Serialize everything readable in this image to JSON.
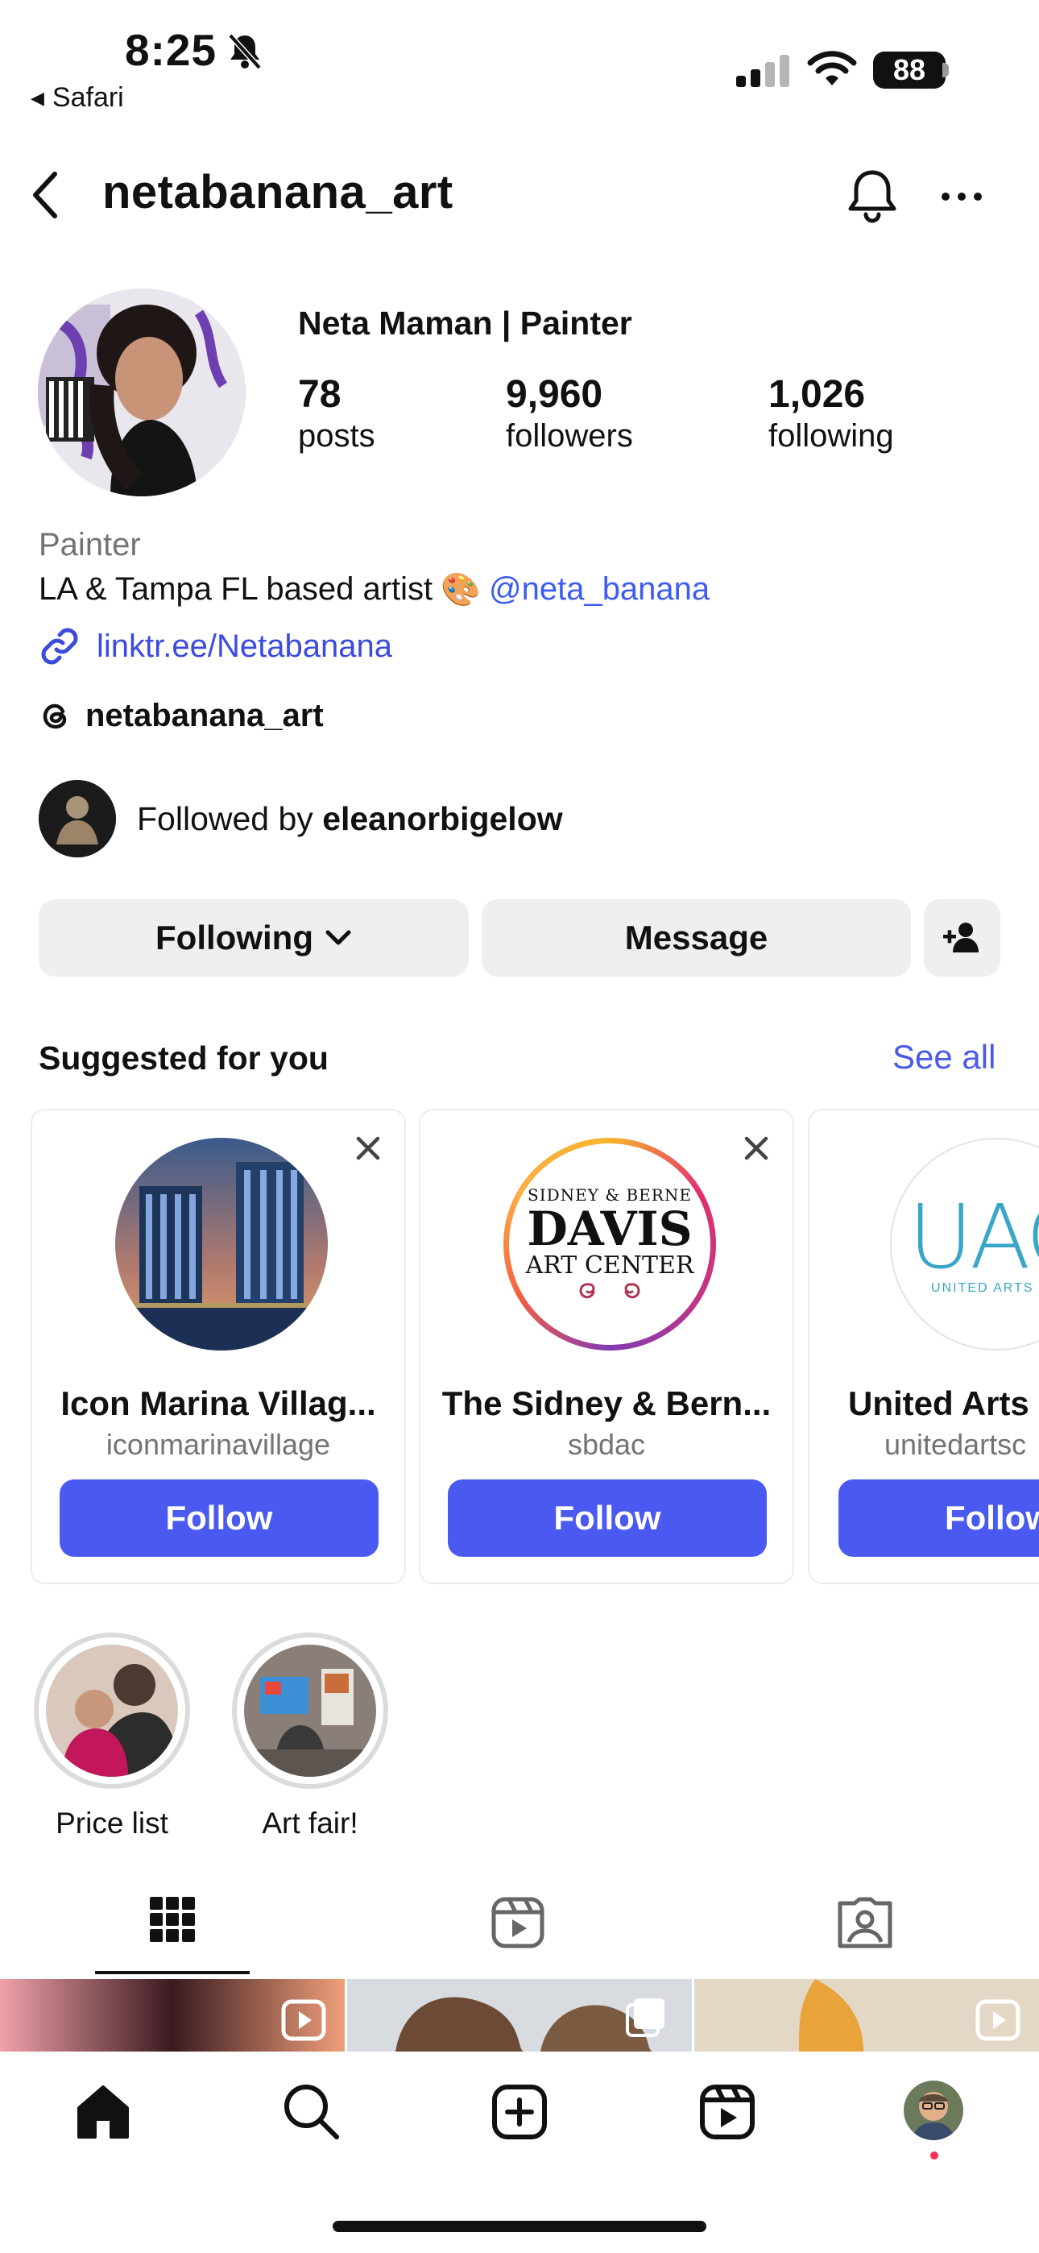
{
  "status_bar": {
    "time": "8:25",
    "back_app": "Safari",
    "battery": "88"
  },
  "header": {
    "username": "netabanana_art",
    "back_icon": "chevron-left-icon",
    "bell_icon": "bell-icon",
    "more_icon": "more-horizontal-icon"
  },
  "profile": {
    "display_name": "Neta Maman | Painter",
    "stats": [
      {
        "count": "78",
        "label": "posts"
      },
      {
        "count": "9,960",
        "label": "followers"
      },
      {
        "count": "1,026",
        "label": "following"
      }
    ],
    "category": "Painter",
    "bio_text": "LA & Tampa FL based artist",
    "bio_emoji": "🎨",
    "bio_mention": "@neta_banana",
    "link": "linktr.ee/Netabanana",
    "threads_handle": "netabanana_art",
    "followed_by_prefix": "Followed by",
    "followed_by_user": "eleanorbigelow"
  },
  "actions": {
    "following": "Following",
    "message": "Message"
  },
  "suggested": {
    "title": "Suggested for you",
    "see_all": "See all",
    "cards": [
      {
        "name": "Icon Marina Villag...",
        "handle": "iconmarinavillage",
        "button": "Follow"
      },
      {
        "name": "The Sidney & Bern...",
        "handle": "sbdac",
        "button": "Follow"
      },
      {
        "name": "United Arts",
        "handle": "unitedartsc",
        "button": "Follow"
      }
    ],
    "davis_logo": {
      "line1": "SIDNEY & BERNE",
      "line2": "DAVIS",
      "line3": "ART CENTER"
    },
    "uac_logo": {
      "mark": "UAC",
      "text": "UNITED ARTS CO"
    }
  },
  "highlights": [
    {
      "label": "Price list"
    },
    {
      "label": "Art fair!"
    }
  ],
  "colors": {
    "accent": "#4a5af0",
    "link": "#3c4bdf",
    "secondary_text": "#737373",
    "button_bg": "#efeff1"
  }
}
